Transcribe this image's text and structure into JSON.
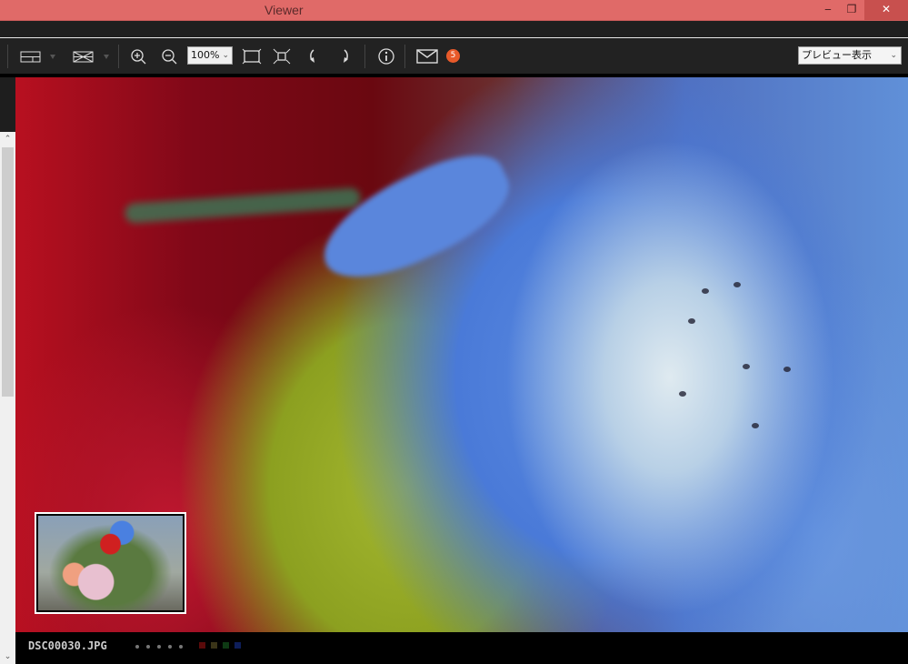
{
  "window": {
    "title": "Viewer",
    "minimize": "‒",
    "restore": "❐",
    "close": "✕"
  },
  "toolbar": {
    "zoom_level": "100%",
    "view_mode": "プレビュー表示",
    "mail_badge": "5",
    "icons": [
      "layout-icon",
      "compare-icon",
      "zoom-in-icon",
      "zoom-out-icon",
      "fit-screen-icon",
      "actual-size-icon",
      "rotate-left-icon",
      "rotate-right-icon",
      "info-icon",
      "mail-icon"
    ]
  },
  "status": {
    "filename": "DSC00030.JPG",
    "rating_dots": 5,
    "color_labels": [
      "#5a0a0a",
      "#3a3418",
      "#0e3a14",
      "#0e1e5a"
    ]
  },
  "scrollbar": {
    "up": "⌃",
    "down": "⌄"
  }
}
